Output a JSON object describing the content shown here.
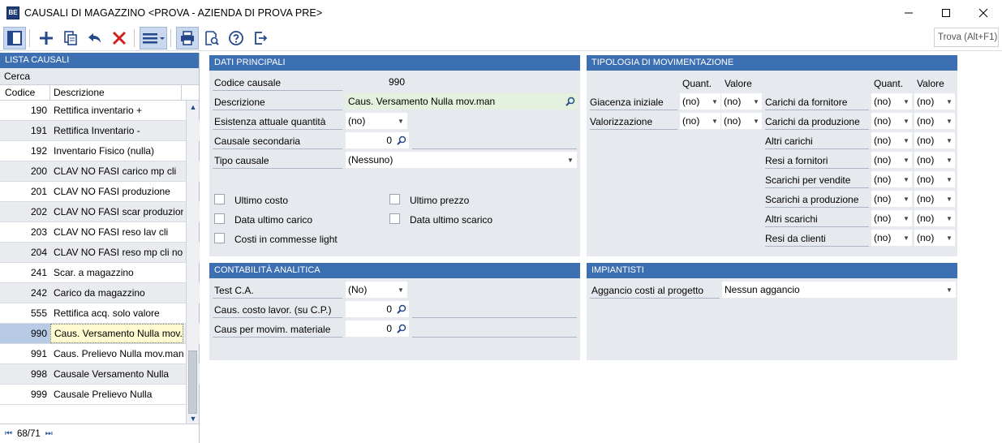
{
  "window": {
    "title": "CAUSALI DI MAGAZZINO <PROVA - AZIENDA DI PROVA PRE>",
    "app_icon_text": "BE"
  },
  "toolbar": {
    "search_placeholder": "Trova (Alt+F1)"
  },
  "list": {
    "header": "LISTA CAUSALI",
    "search_label": "Cerca",
    "col_code": "Codice",
    "col_desc": "Descrizione",
    "rows": [
      {
        "code": "190",
        "desc": "Rettifica inventario +"
      },
      {
        "code": "191",
        "desc": "Rettifica Inventario -"
      },
      {
        "code": "192",
        "desc": "Inventario Fisico (nulla)"
      },
      {
        "code": "200",
        "desc": "CLAV NO FASI carico mp cli"
      },
      {
        "code": "201",
        "desc": "CLAV NO FASI produzione"
      },
      {
        "code": "202",
        "desc": "CLAV NO FASI scar produzione"
      },
      {
        "code": "203",
        "desc": "CLAV NO FASI reso lav cli"
      },
      {
        "code": "204",
        "desc": "CLAV NO FASI reso mp cli no la"
      },
      {
        "code": "241",
        "desc": "Scar. a magazzino"
      },
      {
        "code": "242",
        "desc": "Carico da magazzino"
      },
      {
        "code": "555",
        "desc": "Rettifica acq. solo valore"
      },
      {
        "code": "990",
        "desc": "Caus. Versamento Nulla mov...."
      },
      {
        "code": "991",
        "desc": "Caus. Prelievo Nulla mov.man"
      },
      {
        "code": "998",
        "desc": "Causale Versamento Nulla"
      },
      {
        "code": "999",
        "desc": "Causale Prelievo Nulla"
      }
    ],
    "selected_index": 11,
    "pager": "68/71"
  },
  "dati": {
    "header": "DATI PRINCIPALI",
    "codice_label": "Codice causale",
    "codice_value": "990",
    "descrizione_label": "Descrizione",
    "descrizione_value": "Caus. Versamento Nulla mov.man",
    "esistenza_label": "Esistenza attuale quantità",
    "esistenza_value": "(no)",
    "secondaria_label": "Causale secondaria",
    "secondaria_value": "0",
    "tipo_label": "Tipo causale",
    "tipo_value": "(Nessuno)",
    "ultimo_costo": "Ultimo costo",
    "ultimo_prezzo": "Ultimo prezzo",
    "data_ultimo_carico": "Data ultimo carico",
    "data_ultimo_scarico": "Data ultimo scarico",
    "costi_commesse": "Costi in commesse light"
  },
  "tipologia": {
    "header": "TIPOLOGIA DI MOVIMENTAZIONE",
    "col_quant": "Quant.",
    "col_valore": "Valore",
    "left_rows": [
      {
        "label": "Giacenza iniziale",
        "quant": "(no)",
        "valore": "(no)"
      },
      {
        "label": "Valorizzazione",
        "quant": "(no)",
        "valore": "(no)"
      }
    ],
    "right_rows": [
      {
        "label": "Carichi da fornitore",
        "quant": "(no)",
        "valore": "(no)"
      },
      {
        "label": "Carichi da produzione",
        "quant": "(no)",
        "valore": "(no)"
      },
      {
        "label": "Altri carichi",
        "quant": "(no)",
        "valore": "(no)"
      },
      {
        "label": "Resi a fornitori",
        "quant": "(no)",
        "valore": "(no)"
      },
      {
        "label": "Scarichi per vendite",
        "quant": "(no)",
        "valore": "(no)"
      },
      {
        "label": "Scarichi a produzione",
        "quant": "(no)",
        "valore": "(no)"
      },
      {
        "label": "Altri scarichi",
        "quant": "(no)",
        "valore": "(no)"
      },
      {
        "label": "Resi da clienti",
        "quant": "(no)",
        "valore": "(no)"
      }
    ]
  },
  "contabilita": {
    "header": "CONTABILITÀ ANALITICA",
    "test_label": "Test C.A.",
    "test_value": "(No)",
    "costo_label": "Caus. costo lavor. (su C.P.)",
    "costo_value": "0",
    "movim_label": "Caus per movim. materiale",
    "movim_value": "0"
  },
  "impiantisti": {
    "header": "IMPIANTISTI",
    "aggancio_label": "Aggancio costi al progetto",
    "aggancio_value": "Nessun aggancio"
  },
  "colors": {
    "header_blue": "#3d70b2",
    "panel_gray": "#e6e9ee",
    "icon_blue": "#24488a",
    "delete_red": "#d0201a"
  }
}
